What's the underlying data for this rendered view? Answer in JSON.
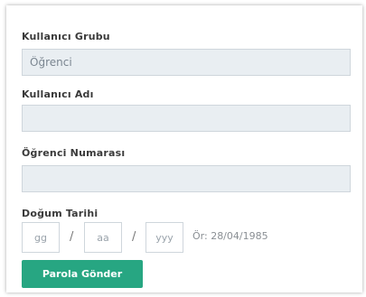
{
  "form": {
    "user_group": {
      "label": "Kullanıcı Grubu",
      "value": "Öğrenci"
    },
    "username": {
      "label": "Kullanıcı Adı",
      "value": ""
    },
    "student_number": {
      "label": "Öğrenci Numarası",
      "value": ""
    },
    "birth_date": {
      "label": "Doğum Tarihi",
      "day_placeholder": "gg",
      "month_placeholder": "aa",
      "year_placeholder": "yyy",
      "separator": "/",
      "example": "Ör: 28/04/1985"
    },
    "submit_label": "Parola Gönder"
  },
  "colors": {
    "accent": "#27a682",
    "field_background": "#e9eef2",
    "field_border": "#cfd6dc",
    "label_text": "#3a3a3a"
  }
}
